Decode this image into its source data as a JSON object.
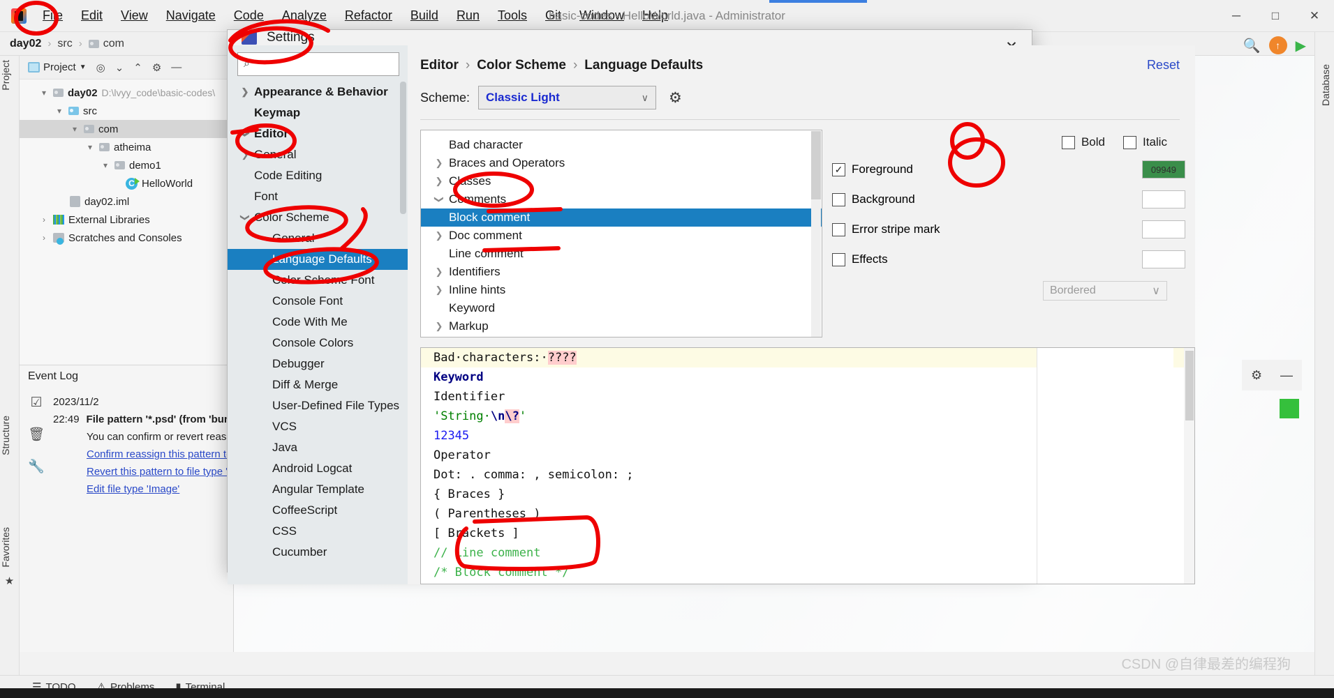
{
  "window": {
    "title": "basic-codes - HelloWorld.java - Administrator",
    "app_icon": "intellij-logo-icon",
    "minimize": "─",
    "maximize": "□",
    "close": "✕"
  },
  "menubar": {
    "items": [
      {
        "label": "File",
        "mnemonic": "F"
      },
      {
        "label": "Edit",
        "mnemonic": "E"
      },
      {
        "label": "View",
        "mnemonic": "V"
      },
      {
        "label": "Navigate",
        "mnemonic": "N"
      },
      {
        "label": "Code",
        "mnemonic": "C"
      },
      {
        "label": "Analyze",
        "mnemonic": "z"
      },
      {
        "label": "Refactor",
        "mnemonic": "R"
      },
      {
        "label": "Build",
        "mnemonic": "B"
      },
      {
        "label": "Run",
        "mnemonic": "u"
      },
      {
        "label": "Tools",
        "mnemonic": "T"
      },
      {
        "label": "Git",
        "mnemonic": "G"
      },
      {
        "label": "Window",
        "mnemonic": "W"
      },
      {
        "label": "Help",
        "mnemonic": "H"
      }
    ]
  },
  "breadcrumb": {
    "items": [
      "day02",
      "src",
      "com"
    ]
  },
  "project_panel": {
    "toolbar_title": "Project",
    "tree": [
      {
        "label": "day02",
        "path": "D:\\lvyy_code\\basic-codes\\",
        "indent": 0,
        "chevron": "v",
        "icon": "module-folder-icon",
        "bold": true
      },
      {
        "label": "src",
        "path": "",
        "indent": 1,
        "chevron": "v",
        "icon": "source-folder-icon",
        "bold": false
      },
      {
        "label": "com",
        "path": "",
        "indent": 2,
        "chevron": "v",
        "icon": "package-folder-icon",
        "bold": false,
        "selected": true
      },
      {
        "label": "atheima",
        "path": "",
        "indent": 3,
        "chevron": "v",
        "icon": "package-folder-icon",
        "bold": false
      },
      {
        "label": "demo1",
        "path": "",
        "indent": 4,
        "chevron": "v",
        "icon": "package-folder-icon",
        "bold": false
      },
      {
        "label": "HelloWorld",
        "path": "",
        "indent": 5,
        "chevron": "",
        "icon": "java-class-icon",
        "bold": false
      },
      {
        "label": "day02.iml",
        "path": "",
        "indent": 2,
        "chevron": "",
        "icon": "iml-file-icon",
        "bold": false
      },
      {
        "label": "External Libraries",
        "path": "",
        "indent": 0,
        "chevron": ">",
        "icon": "libraries-icon",
        "bold": false
      },
      {
        "label": "Scratches and Consoles",
        "path": "",
        "indent": 0,
        "chevron": ">",
        "icon": "scratches-icon",
        "bold": false
      }
    ]
  },
  "left_rail": {
    "labels": [
      "Project",
      "Structure",
      "Favorites"
    ]
  },
  "event_log": {
    "title": "Event Log",
    "date": "2023/11/2",
    "time": "22:49",
    "headline": "File pattern '*.psd' (from 'bun",
    "body": "You can confirm or revert reass",
    "links": [
      "Confirm reassign this pattern to",
      "Revert this pattern to file type '",
      "Edit file type 'Image'"
    ]
  },
  "statusbar": {
    "items": [
      "TODO",
      "Problems",
      "Terminal"
    ]
  },
  "dialog": {
    "title": "Settings",
    "close": "✕",
    "search_placeholder": "",
    "search_value": "",
    "tree": [
      {
        "label": "Appearance & Behavior",
        "level": 0,
        "chevron": ">",
        "selected": false
      },
      {
        "label": "Keymap",
        "level": 0,
        "chevron": "",
        "selected": false
      },
      {
        "label": "Editor",
        "level": 0,
        "chevron": "v",
        "selected": false
      },
      {
        "label": "General",
        "level": 1,
        "chevron": ">",
        "selected": false
      },
      {
        "label": "Code Editing",
        "level": 1,
        "chevron": "",
        "selected": false
      },
      {
        "label": "Font",
        "level": 1,
        "chevron": "",
        "selected": false
      },
      {
        "label": "Color Scheme",
        "level": 1,
        "chevron": "v",
        "selected": false
      },
      {
        "label": "General",
        "level": 2,
        "chevron": "",
        "selected": false
      },
      {
        "label": "Language Defaults",
        "level": 2,
        "chevron": "",
        "selected": true
      },
      {
        "label": "Color Scheme Font",
        "level": 2,
        "chevron": "",
        "selected": false
      },
      {
        "label": "Console Font",
        "level": 2,
        "chevron": "",
        "selected": false
      },
      {
        "label": "Code With Me",
        "level": 2,
        "chevron": "",
        "selected": false
      },
      {
        "label": "Console Colors",
        "level": 2,
        "chevron": "",
        "selected": false
      },
      {
        "label": "Debugger",
        "level": 2,
        "chevron": "",
        "selected": false
      },
      {
        "label": "Diff & Merge",
        "level": 2,
        "chevron": "",
        "selected": false
      },
      {
        "label": "User-Defined File Types",
        "level": 2,
        "chevron": "",
        "selected": false
      },
      {
        "label": "VCS",
        "level": 2,
        "chevron": "",
        "selected": false
      },
      {
        "label": "Java",
        "level": 2,
        "chevron": "",
        "selected": false
      },
      {
        "label": "Android Logcat",
        "level": 2,
        "chevron": "",
        "selected": false
      },
      {
        "label": "Angular Template",
        "level": 2,
        "chevron": "",
        "selected": false
      },
      {
        "label": "CoffeeScript",
        "level": 2,
        "chevron": "",
        "selected": false
      },
      {
        "label": "CSS",
        "level": 2,
        "chevron": "",
        "selected": false
      },
      {
        "label": "Cucumber",
        "level": 2,
        "chevron": "",
        "selected": false
      }
    ],
    "breadcrumb": [
      "Editor",
      "Color Scheme",
      "Language Defaults"
    ],
    "reset_label": "Reset",
    "scheme_label": "Scheme:",
    "scheme_value": "Classic Light",
    "scheme_chevron": "∨",
    "gear_icon": "gear-icon",
    "attributes": [
      {
        "label": "Bad character",
        "level": 0,
        "chevron": "",
        "selected": false
      },
      {
        "label": "Braces and Operators",
        "level": 0,
        "chevron": ">",
        "selected": false
      },
      {
        "label": "Classes",
        "level": 0,
        "chevron": ">",
        "selected": false
      },
      {
        "label": "Comments",
        "level": 0,
        "chevron": "v",
        "selected": false
      },
      {
        "label": "Block comment",
        "level": 1,
        "chevron": "",
        "selected": true
      },
      {
        "label": "Doc comment",
        "level": 1,
        "chevron": ">",
        "selected": false
      },
      {
        "label": "Line comment",
        "level": 1,
        "chevron": "",
        "selected": false
      },
      {
        "label": "Identifiers",
        "level": 0,
        "chevron": ">",
        "selected": false
      },
      {
        "label": "Inline hints",
        "level": 0,
        "chevron": ">",
        "selected": false
      },
      {
        "label": "Keyword",
        "level": 0,
        "chevron": "",
        "selected": false
      },
      {
        "label": "Markup",
        "level": 0,
        "chevron": ">",
        "selected": false
      }
    ],
    "style_options": {
      "bold": {
        "label": "Bold",
        "checked": false
      },
      "italic": {
        "label": "Italic",
        "checked": false
      },
      "foreground": {
        "label": "Foreground",
        "checked": true,
        "color": "#3a8e4a",
        "color_text": "09949"
      },
      "background": {
        "label": "Background",
        "checked": false,
        "color": ""
      },
      "error_stripe": {
        "label": "Error stripe mark",
        "checked": false,
        "color": ""
      },
      "effects": {
        "label": "Effects",
        "checked": false,
        "color": ""
      },
      "effect_type": {
        "value": "Bordered",
        "chevron": "∨"
      }
    },
    "preview": [
      {
        "text": "Bad characters: ????",
        "kind": "bad"
      },
      {
        "text": "Keyword",
        "kind": "keyword"
      },
      {
        "text": "Identifier",
        "kind": "plain"
      },
      {
        "text": "'String \\n\\?'",
        "kind": "string"
      },
      {
        "text": "12345",
        "kind": "number"
      },
      {
        "text": "Operator",
        "kind": "plain"
      },
      {
        "text": "Dot: . comma: , semicolon: ;",
        "kind": "plain"
      },
      {
        "text": "{ Braces }",
        "kind": "plain"
      },
      {
        "text": "( Parentheses )",
        "kind": "plain"
      },
      {
        "text": "[ Brackets ]",
        "kind": "plain"
      },
      {
        "text": "// Line comment",
        "kind": "comment"
      },
      {
        "text": "/* Block comment */",
        "kind": "comment"
      }
    ]
  },
  "watermark": "CSDN @自律最差的编程狗",
  "colors": {
    "selection_blue": "#1a7fc1",
    "annotation_red": "#ee0000",
    "link_blue": "#2a49c8",
    "comment_green": "#3cb24a"
  }
}
